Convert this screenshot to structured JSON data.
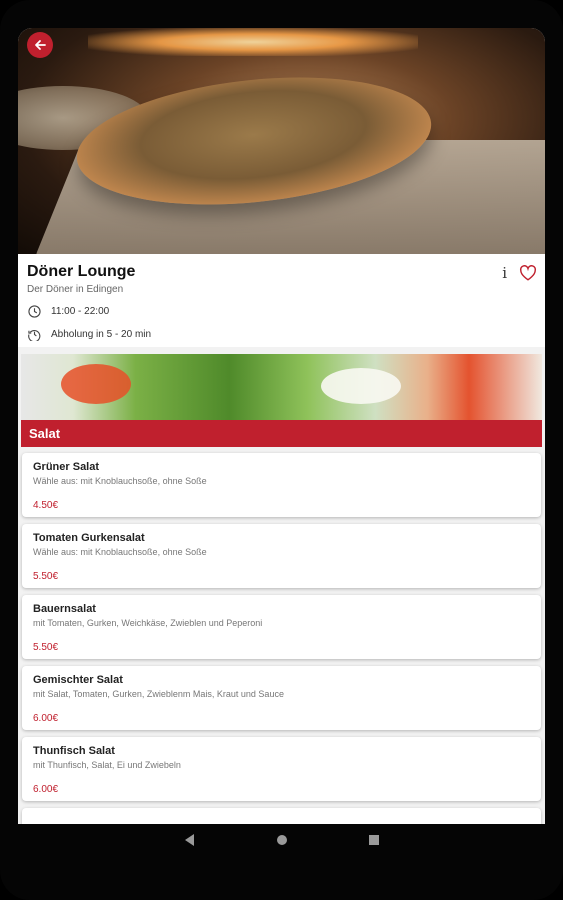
{
  "restaurant": {
    "name": "Döner Lounge",
    "subtitle": "Der Döner in Edingen",
    "hours": "11:00 - 22:00",
    "pickup": "Abholung in 5 - 20 min",
    "info_symbol": "i"
  },
  "header": {
    "back_icon": "arrow-left-icon"
  },
  "category": {
    "title": "Salat"
  },
  "items": [
    {
      "name": "Grüner Salat",
      "description": "Wähle aus: mit Knoblauchsoße, ohne Soße",
      "price": "4.50€"
    },
    {
      "name": "Tomaten Gurkensalat",
      "description": "Wähle aus: mit Knoblauchsoße, ohne Soße",
      "price": "5.50€"
    },
    {
      "name": "Bauernsalat",
      "description": "mit Tomaten, Gurken, Weichkäse, Zwieblen und Peperoni",
      "price": "5.50€"
    },
    {
      "name": "Gemischter Salat",
      "description": "mit Salat, Tomaten, Gurken, Zwieblenm Mais, Kraut und Sauce",
      "price": "6.00€"
    },
    {
      "name": "Thunfisch Salat",
      "description": "mit Thunfisch, Salat, Ei und Zwiebeln",
      "price": "6.00€"
    }
  ],
  "colors": {
    "accent": "#c0202e"
  },
  "system_nav": {
    "back_icon": "triangle-back-icon",
    "home_icon": "circle-home-icon",
    "recents_icon": "square-recents-icon"
  }
}
